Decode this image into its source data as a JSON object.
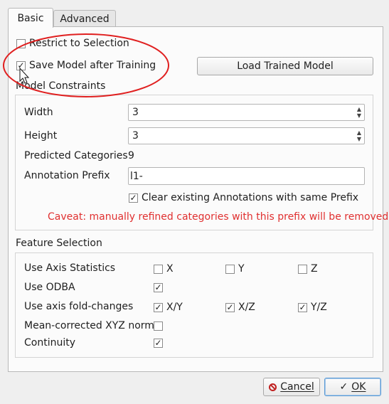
{
  "tabs": [
    {
      "label": "Basic",
      "active": true
    },
    {
      "label": "Advanced",
      "active": false
    }
  ],
  "basic": {
    "restrict_label": "Restrict to Selection",
    "restrict_checked": false,
    "save_model_label": "Save Model after Training",
    "save_model_checked": true,
    "load_model_button": "Load Trained Model"
  },
  "model_constraints": {
    "title": "Model Constraints",
    "width_label": "Width",
    "width_value": "3",
    "height_label": "Height",
    "height_value": "3",
    "predicted_label": "Predicted Categories",
    "predicted_value": "9",
    "prefix_label": "Annotation Prefix",
    "prefix_value": "l1-",
    "clear_label": "Clear existing Annotations with same Prefix",
    "clear_checked": true,
    "caveat": "Caveat: manually refined categories with this prefix will be removed"
  },
  "feature_selection": {
    "title": "Feature Selection",
    "axis_stats_label": "Use Axis Statistics",
    "axis_stats": [
      {
        "label": "X",
        "checked": false
      },
      {
        "label": "Y",
        "checked": false
      },
      {
        "label": "Z",
        "checked": false
      }
    ],
    "odba_label": "Use ODBA",
    "odba_checked": true,
    "fold_label": "Use axis fold-changes",
    "fold": [
      {
        "label": "X/Y",
        "checked": true
      },
      {
        "label": "X/Z",
        "checked": true
      },
      {
        "label": "Y/Z",
        "checked": true
      }
    ],
    "norm_label": "Mean-corrected XYZ norm",
    "norm_checked": false,
    "continuity_label": "Continuity",
    "continuity_checked": true
  },
  "footer": {
    "cancel_label": "Cancel",
    "ok_label": "OK"
  },
  "colors": {
    "annotation_ellipse": "#e02020",
    "caveat_text": "#e03030",
    "ok_focus": "#5b9bd5"
  },
  "icons": {
    "check": "✓",
    "cancel": "cancel-icon",
    "ok": "check-icon"
  }
}
